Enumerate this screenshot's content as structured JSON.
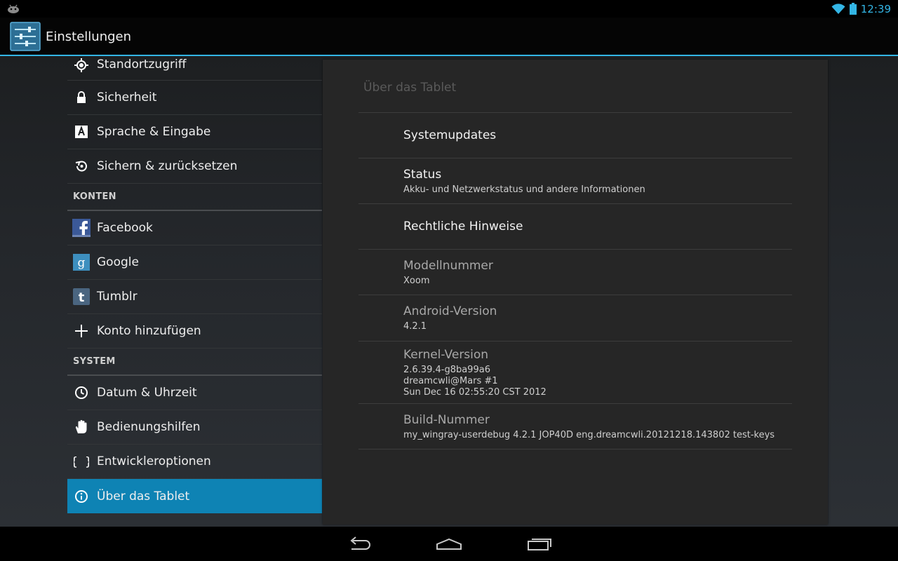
{
  "status_bar": {
    "time": "12:39"
  },
  "action_bar": {
    "title": "Einstellungen"
  },
  "left_list": {
    "top_items": [
      {
        "label": "Standortzugriff",
        "icon": "location-icon"
      },
      {
        "label": "Sicherheit",
        "icon": "lock-icon"
      },
      {
        "label": "Sprache & Eingabe",
        "icon": "keyboard-language-icon"
      },
      {
        "label": "Sichern & zurücksetzen",
        "icon": "backup-restore-icon"
      }
    ],
    "accounts_header": "KONTEN",
    "accounts": [
      {
        "label": "Facebook",
        "icon": "facebook-icon"
      },
      {
        "label": "Google",
        "icon": "google-icon"
      },
      {
        "label": "Tumblr",
        "icon": "tumblr-icon"
      },
      {
        "label": "Konto hinzufügen",
        "icon": "add-icon"
      }
    ],
    "system_header": "SYSTEM",
    "system": [
      {
        "label": "Datum & Uhrzeit",
        "icon": "clock-icon"
      },
      {
        "label": "Bedienungshilfen",
        "icon": "accessibility-hand-icon"
      },
      {
        "label": "Entwickleroptionen",
        "icon": "braces-icon"
      },
      {
        "label": "Über das Tablet",
        "icon": "info-icon",
        "selected": true
      }
    ]
  },
  "panel": {
    "title": "Über das Tablet",
    "prefs": [
      {
        "title": "Systemupdates",
        "summary": ""
      },
      {
        "title": "Status",
        "summary": "Akku- und Netzwerkstatus und andere Informationen"
      },
      {
        "title": "Rechtliche Hinweise",
        "summary": ""
      },
      {
        "title": "Modellnummer",
        "summary": "Xoom"
      },
      {
        "title": "Android-Version",
        "summary": "4.2.1"
      },
      {
        "title": "Kernel-Version",
        "summary": "2.6.39.4-g8ba99a6\ndreamcwli@Mars #1\nSun Dec 16 02:55:20 CST 2012"
      },
      {
        "title": "Build-Nummer",
        "summary": "my_wingray-userdebug 4.2.1 JOP40D eng.dreamcwli.20121218.143802 test-keys"
      }
    ]
  },
  "colors": {
    "accent": "#33b5e5",
    "selected": "#0e83b4"
  }
}
